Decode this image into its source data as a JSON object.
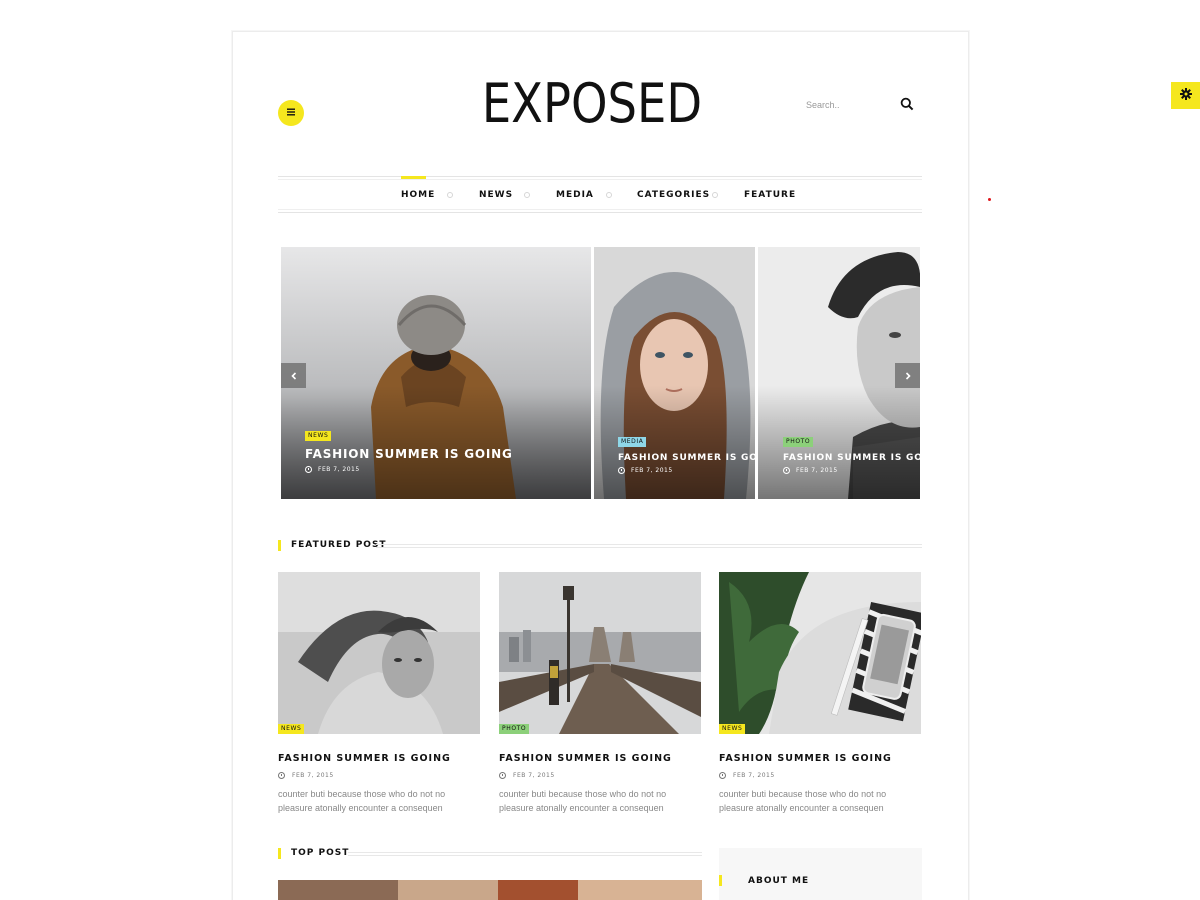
{
  "header": {
    "logo": "EXPOSED",
    "search_placeholder": "Search..",
    "menu_icon": "hamburger-icon",
    "search_icon": "search-icon",
    "settings_icon": "gear-icon"
  },
  "nav": {
    "items": [
      "HOME",
      "NEWS",
      "MEDIA",
      "CATEGORIES",
      "FEATURE"
    ],
    "active": "HOME"
  },
  "slider": {
    "slides": [
      {
        "badge": "NEWS",
        "title": "FASHION SUMMER IS GOING",
        "date": "FEB 7, 2015"
      },
      {
        "badge": "MEDIA",
        "title": "FASHION SUMMER IS GOING",
        "date": "FEB 7, 2015"
      },
      {
        "badge": "PHOTO",
        "title": "FASHION SUMMER IS GOING",
        "date": "FEB 7, 2015"
      }
    ],
    "prev_icon": "chevron-left-icon",
    "next_icon": "chevron-right-icon"
  },
  "featured": {
    "heading": "FEATURED POST",
    "cards": [
      {
        "badge": "NEWS",
        "title": "FASHION SUMMER IS GOING",
        "date": "FEB 7, 2015",
        "excerpt": "counter buti because those who do not no pleasure atonally encounter a consequen"
      },
      {
        "badge": "PHOTO",
        "title": "FASHION SUMMER IS GOING",
        "date": "FEB 7, 2015",
        "excerpt": "counter buti because those who do not no pleasure atonally encounter a consequen"
      },
      {
        "badge": "NEWS",
        "title": "FASHION SUMMER IS GOING",
        "date": "FEB 7, 2015",
        "excerpt": "counter buti because those who do not no pleasure atonally encounter a consequen"
      }
    ]
  },
  "top_post": {
    "heading": "TOP POST"
  },
  "sidebar": {
    "about_heading": "ABOUT ME"
  },
  "colors": {
    "accent": "#f5e71e",
    "media_badge": "#8fd7e8",
    "photo_badge": "#8cd07a"
  }
}
